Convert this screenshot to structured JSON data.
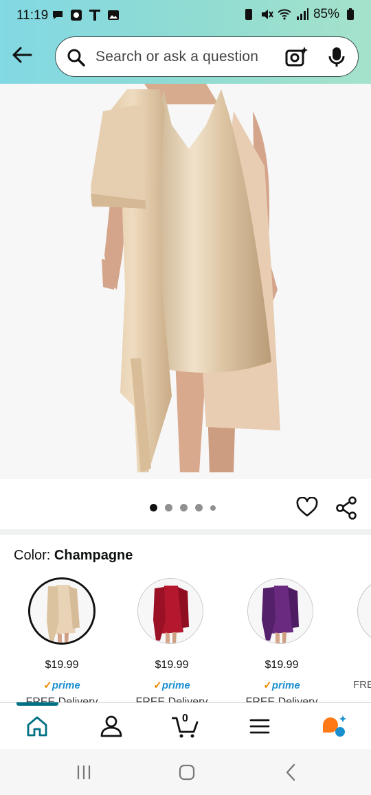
{
  "status_bar": {
    "time": "11:19",
    "battery": "85%"
  },
  "search": {
    "placeholder": "Search or ask a question"
  },
  "carousel": {
    "image_count": 5,
    "active_index": 0
  },
  "color_selector": {
    "label": "Color:",
    "selected": "Champagne",
    "options": [
      {
        "price": "$19.99",
        "prime": "prime",
        "delivery": "FREE Delivery"
      },
      {
        "price": "$19.99",
        "prime": "prime",
        "delivery": "FREE Delivery"
      },
      {
        "price": "$19.99",
        "prime": "prime",
        "delivery": "FREE Delivery"
      },
      {
        "price": "",
        "prime": "FRE",
        "delivery": ""
      }
    ]
  },
  "bottom_nav": {
    "cart_count": "0",
    "active": "home"
  },
  "colors": {
    "header_gradient_start": "#82d8e3",
    "header_gradient_end": "#a5e2cb",
    "prime_blue": "#1a8fd0",
    "prime_check": "#f08804",
    "nav_active": "#007185",
    "champagne": "#e2cdb0",
    "red_variant": "#a5142a",
    "purple_variant": "#5a1f6e"
  },
  "icons": [
    "back-arrow-icon",
    "search-icon",
    "camera-icon",
    "mic-icon",
    "heart-icon",
    "share-icon",
    "home-icon",
    "account-icon",
    "cart-icon",
    "menu-icon",
    "rufus-icon"
  ]
}
